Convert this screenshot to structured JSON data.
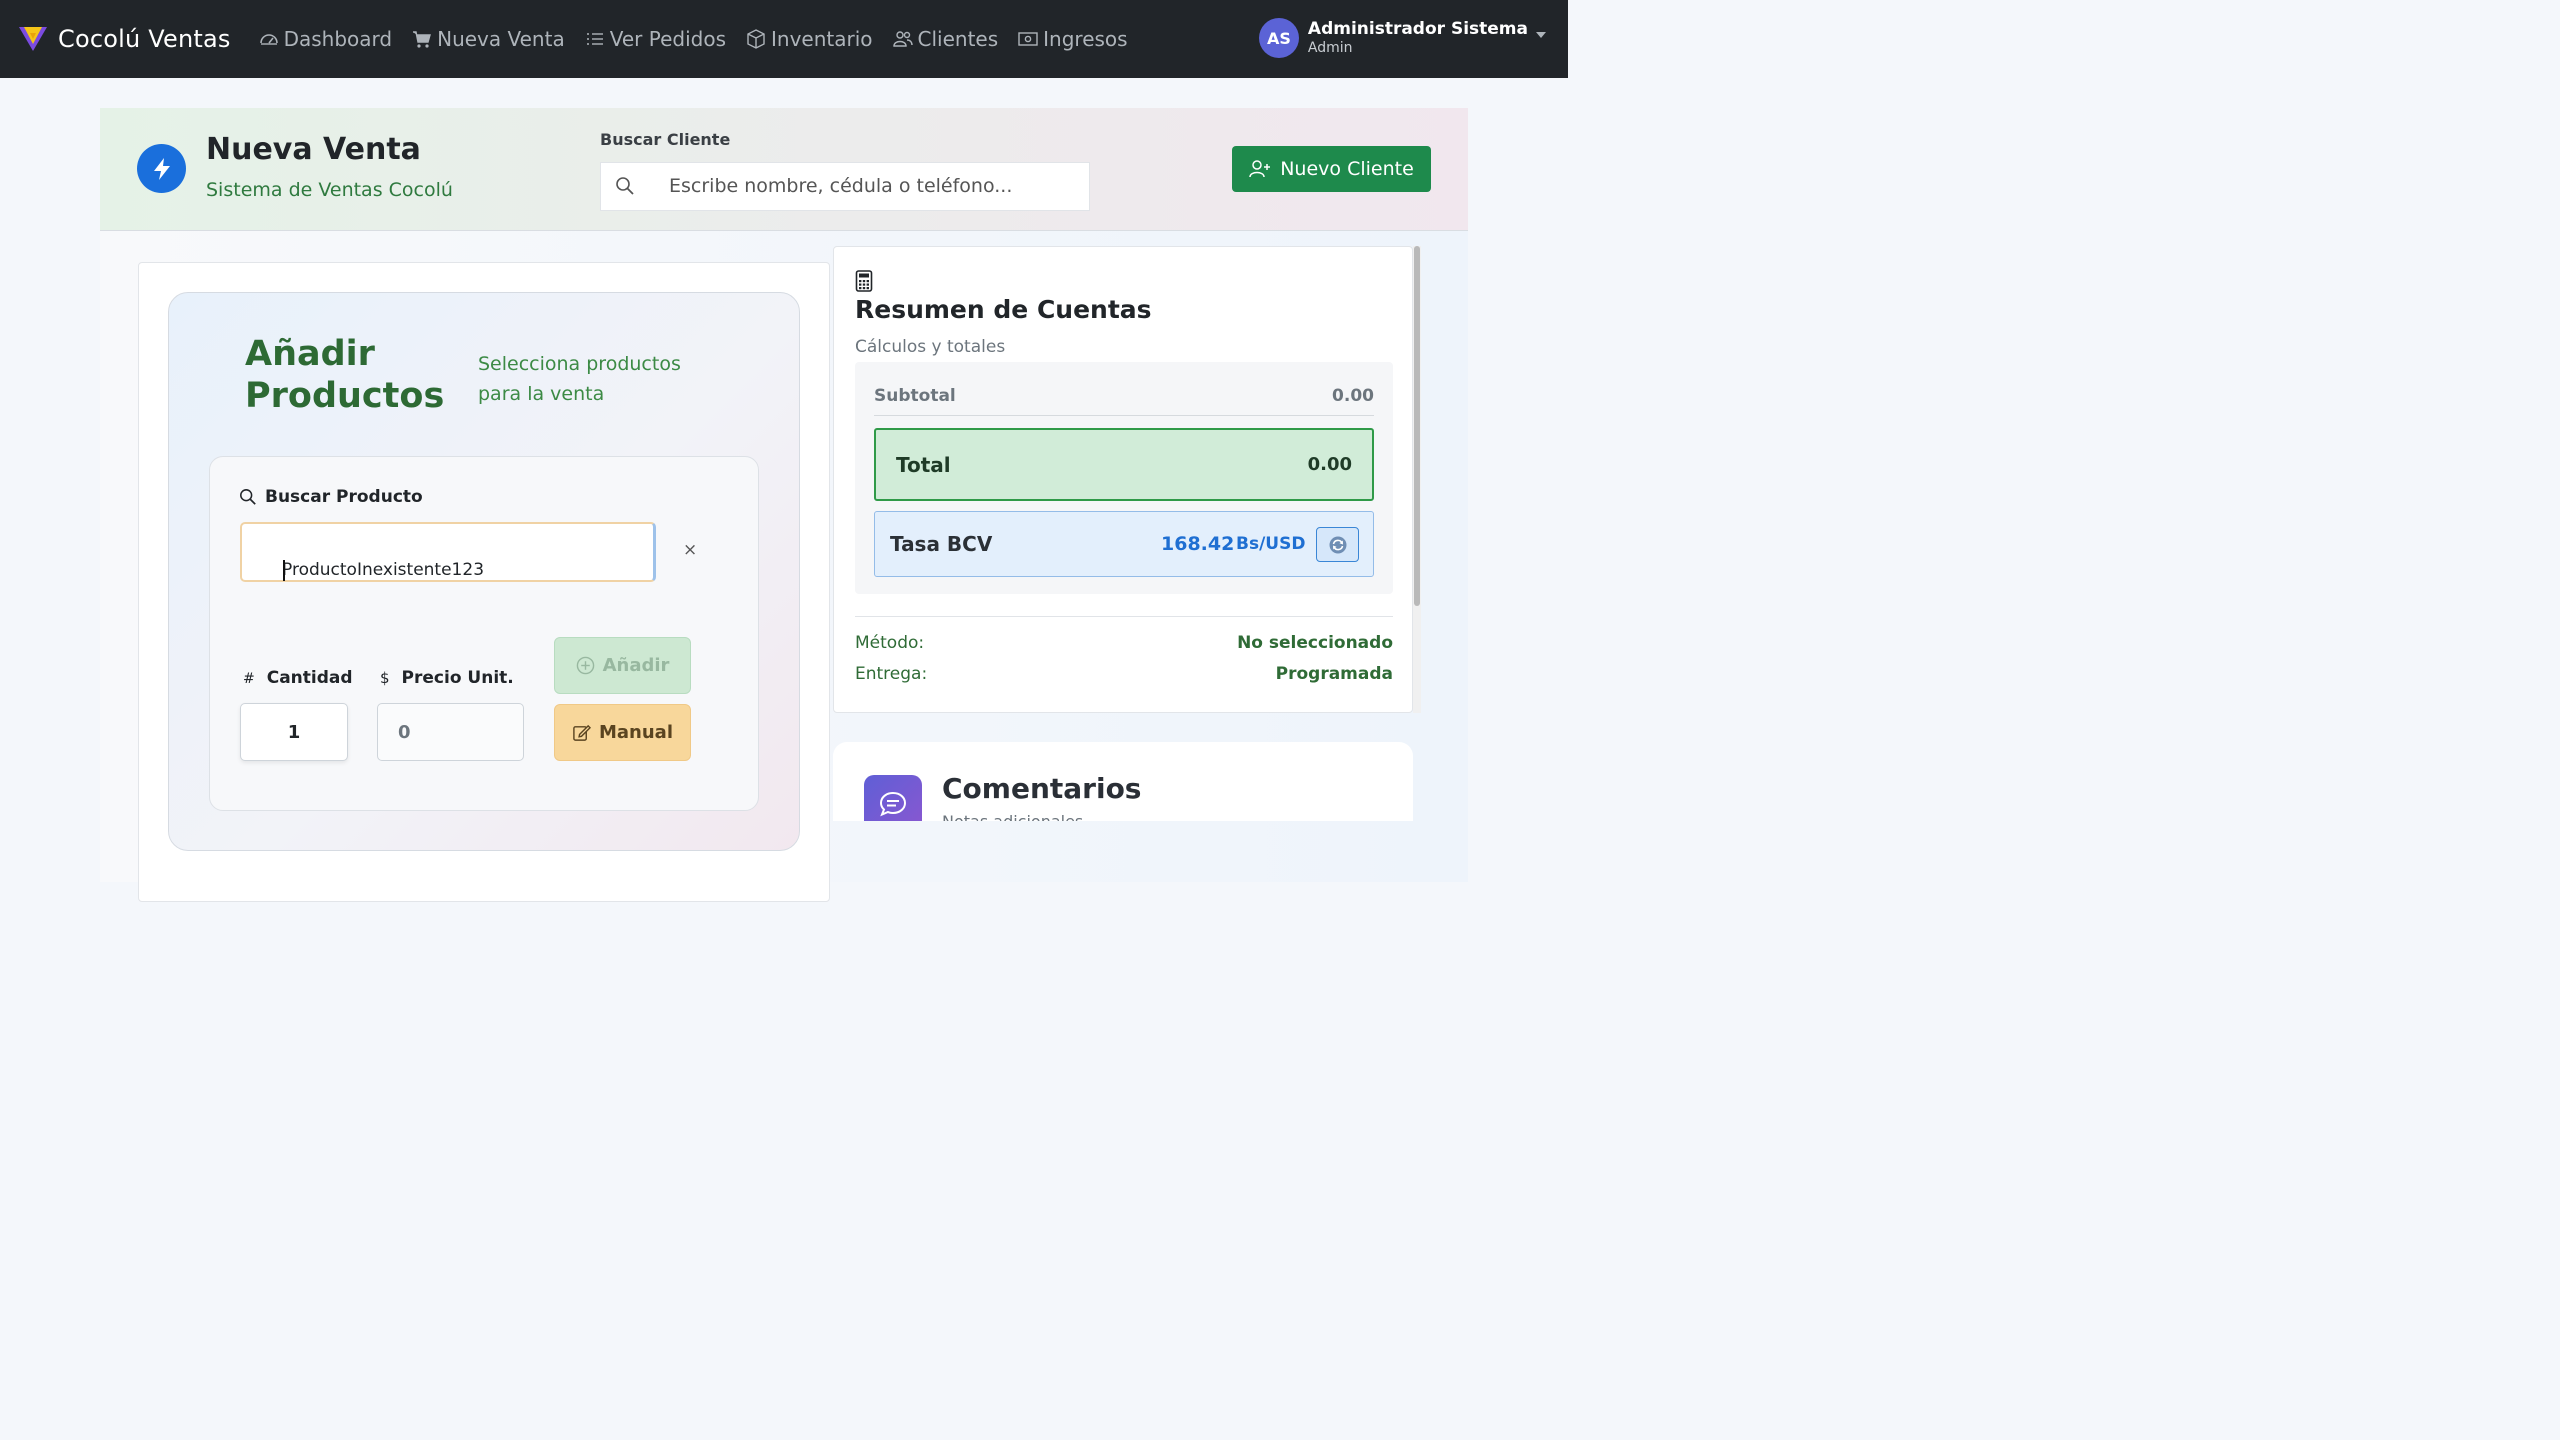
{
  "navbar": {
    "brand": "Cocolú Ventas",
    "links": [
      {
        "label": "Dashboard",
        "icon": "speedometer-icon"
      },
      {
        "label": "Nueva Venta",
        "icon": "cart-icon"
      },
      {
        "label": "Ver Pedidos",
        "icon": "list-icon"
      },
      {
        "label": "Inventario",
        "icon": "box-icon"
      },
      {
        "label": "Clientes",
        "icon": "people-icon"
      },
      {
        "label": "Ingresos",
        "icon": "cash-icon"
      }
    ],
    "user": {
      "initials": "AS",
      "name": "Administrador Sistema",
      "role": "Admin"
    }
  },
  "header": {
    "title": "Nueva Venta",
    "subtitle": "Sistema de Ventas Cocolú",
    "customer_label": "Buscar Cliente",
    "customer_placeholder": "Escribe nombre, cédula o teléfono...",
    "new_customer_button": "Nuevo Cliente"
  },
  "add_products": {
    "title_line1": "Añadir",
    "title_line2": "Productos",
    "subtitle_line1": "Selecciona productos",
    "subtitle_line2": "para la venta",
    "search_label": "Buscar Producto",
    "search_value": "ProductoInexistente123",
    "clear_symbol": "×",
    "quantity_label": "Cantidad",
    "quantity_symbol": "#",
    "quantity_value": "1",
    "price_label": "Precio Unit.",
    "price_symbol": "$",
    "price_value": "0",
    "add_button": "Añadir",
    "manual_button": "Manual"
  },
  "summary": {
    "title": "Resumen de Cuentas",
    "subtitle": "Cálculos y totales",
    "subtotal_label": "Subtotal",
    "subtotal_value": "0.00",
    "total_label": "Total",
    "total_value": "0.00",
    "bcv_label": "Tasa BCV",
    "bcv_value": "168.42",
    "bcv_unit": "Bs/USD",
    "method_label": "Método:",
    "method_value": "No seleccionado",
    "delivery_label": "Entrega:",
    "delivery_value": "Programada"
  },
  "comments": {
    "title": "Comentarios",
    "subtitle": "Notas adicionales"
  },
  "colors": {
    "navbar": "#212529",
    "primary_green": "#1e8a4c",
    "accent_blue": "#1a6fdc",
    "total_bg": "#d1ecd8",
    "manual_bg": "#f8d79b"
  }
}
